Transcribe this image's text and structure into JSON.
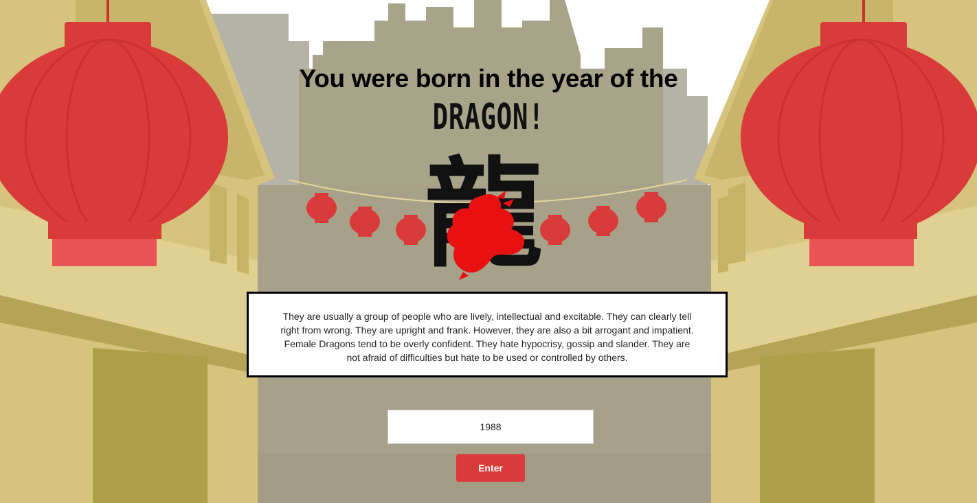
{
  "headline": "You were born in the year of the",
  "sign": {
    "name": "DRAGON!",
    "glyph": "龍",
    "icon": "dragon-icon"
  },
  "description": "They are usually a group of people who are lively, intellectual and excitable. They can clearly tell right from wrong. They are upright and frank. However, they are also a bit arrogant and impatient. Female Dragons tend to be overly confident. They hate hypocrisy, gossip and slander. They are not afraid of difficulties but hate to be used or controlled by others.",
  "form": {
    "year_value": "1988",
    "enter_label": "Enter"
  },
  "colors": {
    "lantern_red": "#d93a3a",
    "building_gold": "#d4c37c",
    "street_gray": "#a8a189",
    "dragon_red": "#e81010"
  }
}
